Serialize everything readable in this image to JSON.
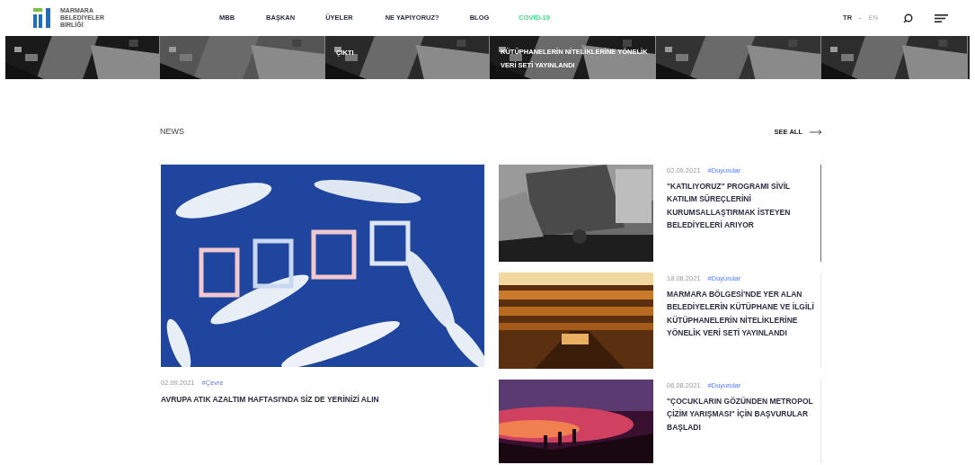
{
  "header": {
    "logo_lines": [
      "MARMARA",
      "BELEDİYELER",
      "BİRLİĞİ"
    ],
    "nav": [
      {
        "label": "MBB",
        "highlighted": false
      },
      {
        "label": "BAŞKAN",
        "highlighted": false
      },
      {
        "label": "ÜYELER",
        "highlighted": false
      },
      {
        "label": "NE YAPIYORUZ?",
        "highlighted": false
      },
      {
        "label": "BLOG",
        "highlighted": false
      },
      {
        "label": "COVID-19",
        "highlighted": true
      }
    ],
    "languages": [
      {
        "label": "TR",
        "selected": true
      },
      {
        "label": "EN",
        "selected": false
      }
    ],
    "language_separator": "-"
  },
  "slider": {
    "slides": [
      {
        "kind": "picture"
      },
      {
        "kind": "picture"
      },
      {
        "kind": "picture",
        "title_lines": [
          "ÇIKTI"
        ]
      },
      {
        "kind": "picture",
        "title_lines": [
          "KÜTÜPHANELERİN NİTELİKLERİNE YÖNELİK",
          "VERİ SETİ YAYINLANDI"
        ]
      },
      {
        "kind": "picture"
      },
      {
        "kind": "picture"
      }
    ]
  },
  "news": {
    "heading": "NEWS",
    "see_all": "SEE ALL",
    "featured": {
      "date": "02.09.2021",
      "tag": "#Çevre",
      "title": "AVRUPA ATIK AZALTIM HAFTASI'NDA SİZ DE YERİNİZİ ALIN"
    },
    "items": [
      {
        "date": "02.09.2021",
        "tag": "#Duyurular",
        "title": "\"KATILIYORUZ\" PROGRAMI SİVİL KATILIM SÜREÇLERİNİ KURUMSALLAŞTIRMAK İSTEYEN BELEDİYELERİ ARIYOR",
        "selected": true
      },
      {
        "date": "18.08.2021",
        "tag": "#Duyurular",
        "title": "MARMARA BÖLGESİ'NDE YER ALAN BELEDİYELERİN KÜTÜPHANE VE İLGİLİ KÜTÜPHANELERİN NİTELİKLERİNE YÖNELİK VERİ SETİ YAYINLANDI",
        "selected": false
      },
      {
        "date": "06.08.2021",
        "tag": "#Duyurular",
        "title": "\"ÇOCUKLARIN GÖZÜNDEN METROPOL ÇİZİM YARIŞMASI\" İÇİN BAŞVURULAR BAŞLADI",
        "selected": false
      }
    ]
  }
}
